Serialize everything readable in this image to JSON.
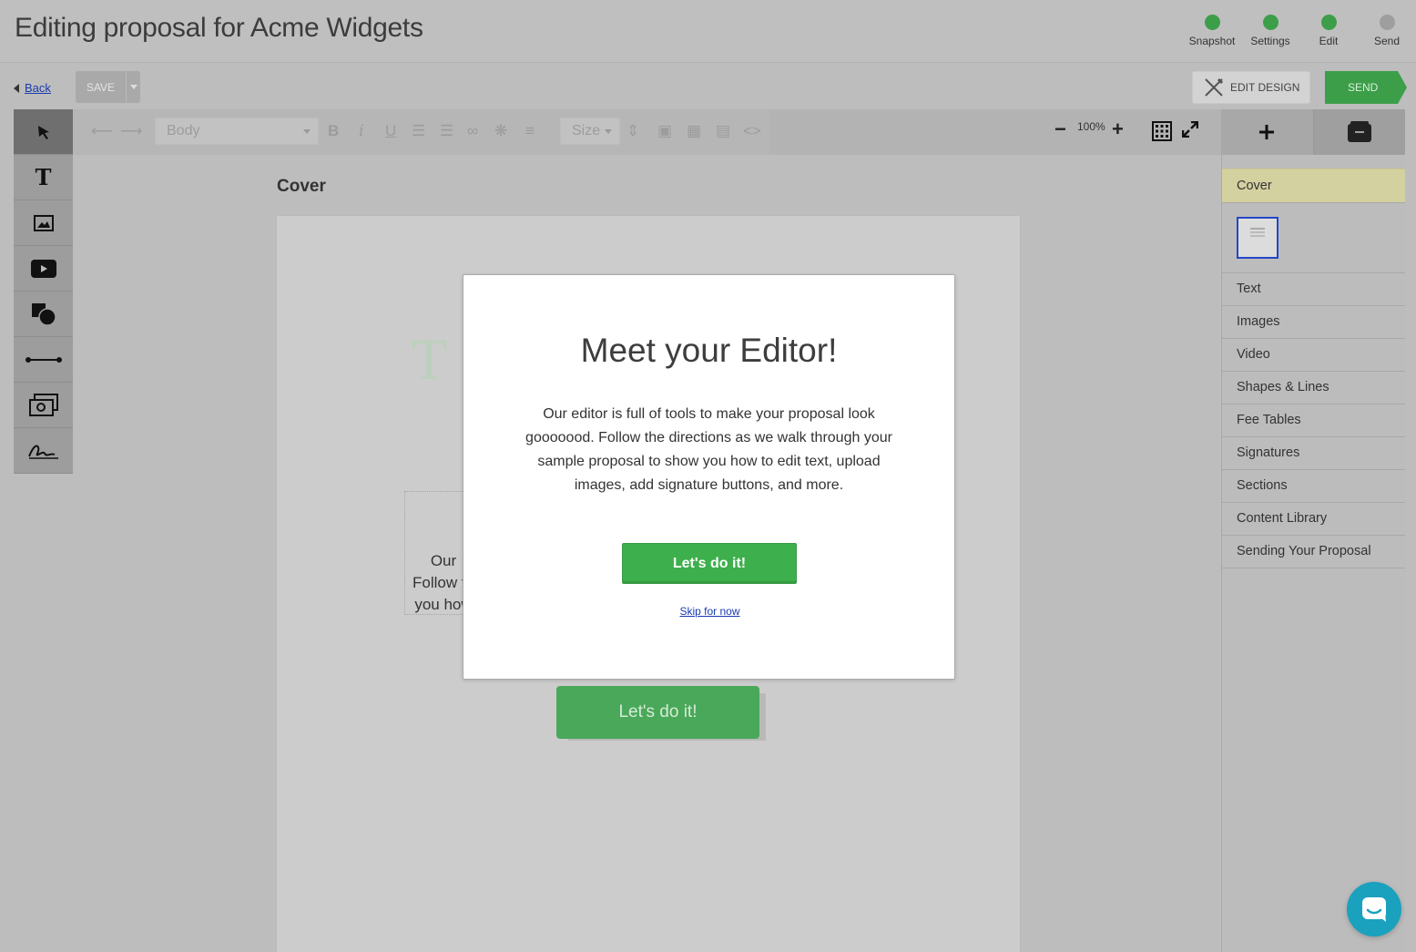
{
  "header": {
    "title": "Editing proposal for Acme Widgets",
    "steps": [
      {
        "label": "Snapshot",
        "status": "complete"
      },
      {
        "label": "Settings",
        "status": "complete"
      },
      {
        "label": "Edit",
        "status": "complete"
      },
      {
        "label": "Send",
        "status": "incomplete"
      }
    ]
  },
  "actions": {
    "back_label": "Back",
    "save_label": "SAVE",
    "edit_design_label": "EDIT DESIGN",
    "send_label": "SEND"
  },
  "toolbar": {
    "style_select": "Body",
    "size_select": "Size",
    "zoom_level": "100%"
  },
  "tools": [
    "pointer-icon",
    "text-icon",
    "image-icon",
    "video-icon",
    "shapes-icon",
    "line-icon",
    "fee-table-icon",
    "signature-icon"
  ],
  "canvas": {
    "section_title": "Cover",
    "ghost_text_fragments": [
      "Our",
      "Follow th",
      "you how"
    ],
    "ghost_cta_label": "Let's do it!"
  },
  "right_panel": {
    "items": [
      "Cover",
      "Text",
      "Images",
      "Video",
      "Shapes & Lines",
      "Fee Tables",
      "Signatures",
      "Sections",
      "Content Library",
      "Sending Your Proposal"
    ]
  },
  "modal": {
    "title": "Meet your Editor!",
    "body": "Our editor is full of tools to make your proposal look gooooood. Follow the directions as we walk through your sample proposal to show you how to edit text, upload images, add signature buttons, and more.",
    "cta_label": "Let's do it!",
    "skip_label": "Skip for now"
  },
  "colors": {
    "accent_green": "#3daf4c",
    "step_complete": "#3d9e4a",
    "step_incomplete": "#9e9e9e",
    "cover_highlight": "#d4d1a0",
    "chat_bubble": "#1aa1be",
    "link_blue": "#1a3bb0"
  }
}
